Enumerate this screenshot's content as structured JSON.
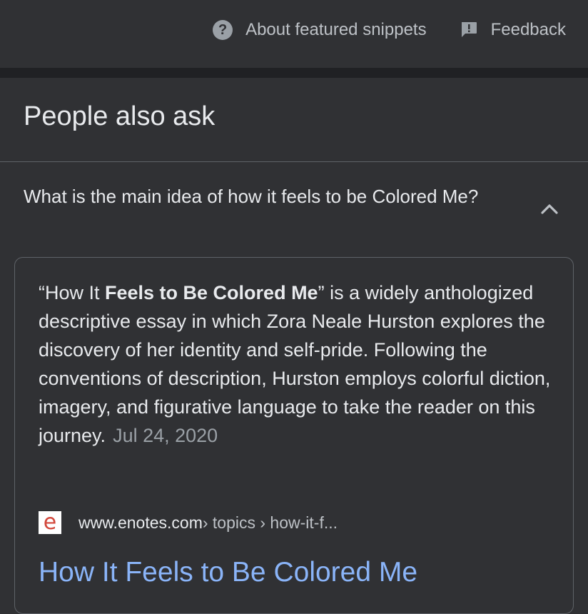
{
  "header": {
    "about_label": "About featured snippets",
    "feedback_label": "Feedback"
  },
  "paa": {
    "title": "People also ask",
    "question": "What is the main idea of how it feels to be Colored Me?"
  },
  "answer": {
    "quote_open": "“How It ",
    "bold": "Feels to Be Colored Me",
    "rest": "” is a widely anthologized descriptive essay in which Zora Neale Hurston explores the discovery of her identity and self-pride. Following the conventions of description, Hurston employs colorful diction, imagery, and figurative language to take the reader on this journey.",
    "date": "Jul 24, 2020"
  },
  "source": {
    "favicon_letter": "e",
    "domain": "www.enotes.com",
    "path": " › topics › how-it-f..."
  },
  "result": {
    "title": "How It Feels to Be Colored Me"
  },
  "colors": {
    "background": "#303134",
    "divider": "#202124",
    "link": "#8ab4f8",
    "favicon": "#d2473b"
  }
}
